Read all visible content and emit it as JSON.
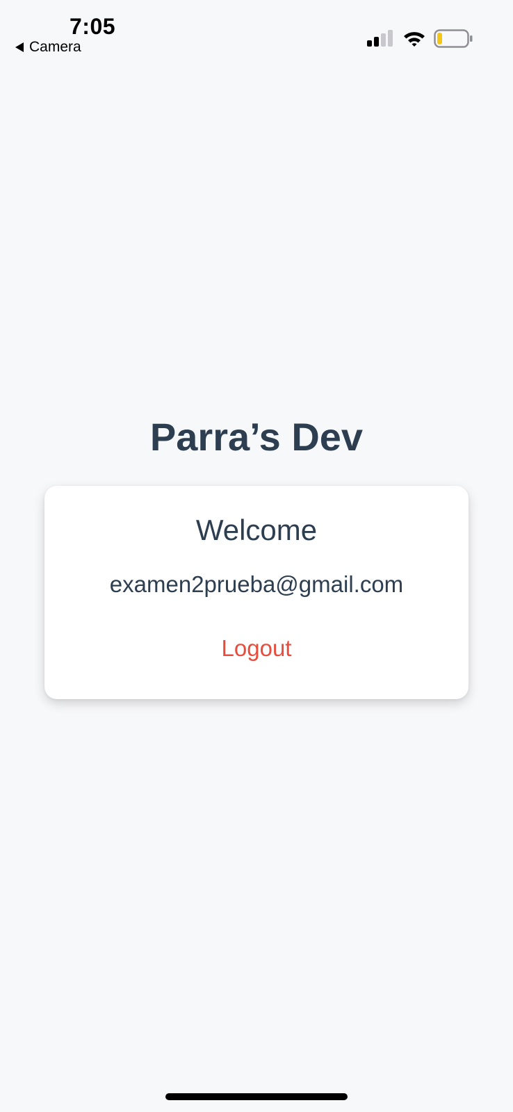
{
  "status_bar": {
    "time": "7:05",
    "back_label": "Camera",
    "icons": [
      "cellular-signal-icon",
      "wifi-icon",
      "battery-icon"
    ],
    "battery_color": "#f5c518"
  },
  "app": {
    "title": "Parra’s Dev"
  },
  "card": {
    "welcome": "Welcome",
    "email": "examen2prueba@gmail.com",
    "logout_label": "Logout"
  },
  "colors": {
    "background": "#f7f8fa",
    "text_primary": "#2c3e50",
    "logout": "#e74c3c",
    "card": "#ffffff"
  }
}
